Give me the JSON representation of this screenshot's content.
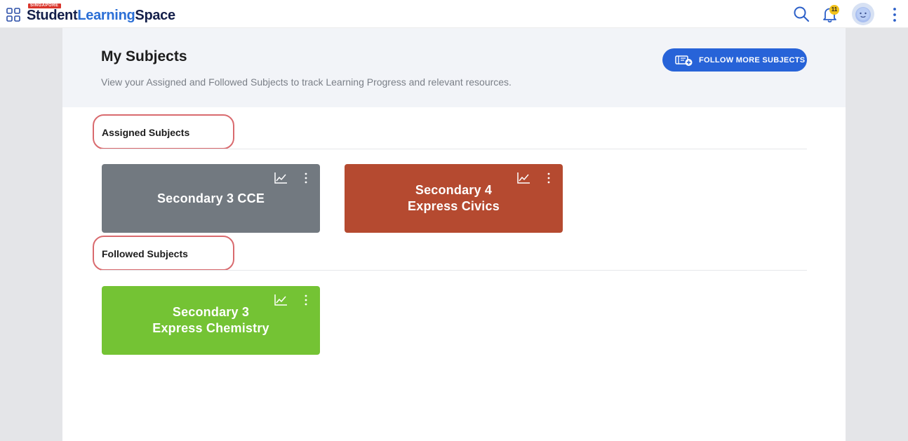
{
  "topbar": {
    "logo_badge": "SINGAPORE",
    "logo_student": "Student",
    "logo_learning": "Learning",
    "logo_space": "Space",
    "notification_count": "11"
  },
  "header": {
    "title": "My Subjects",
    "subtitle": "View your Assigned and Followed Subjects to track Learning Progress and relevant resources.",
    "follow_button_label": "FOLLOW MORE SUBJECTS"
  },
  "assigned": {
    "heading": "Assigned Subjects",
    "cards": [
      {
        "title": "Secondary 3 CCE",
        "color": "#727980"
      },
      {
        "title": "Secondary 4\nExpress Civics",
        "color": "#b54a30"
      }
    ]
  },
  "followed": {
    "heading": "Followed Subjects",
    "cards": [
      {
        "title": "Secondary 3\nExpress Chemistry",
        "color": "#74c334"
      }
    ]
  },
  "colors": {
    "accent": "#2763d8",
    "highlight_outline": "#d96a6e"
  }
}
